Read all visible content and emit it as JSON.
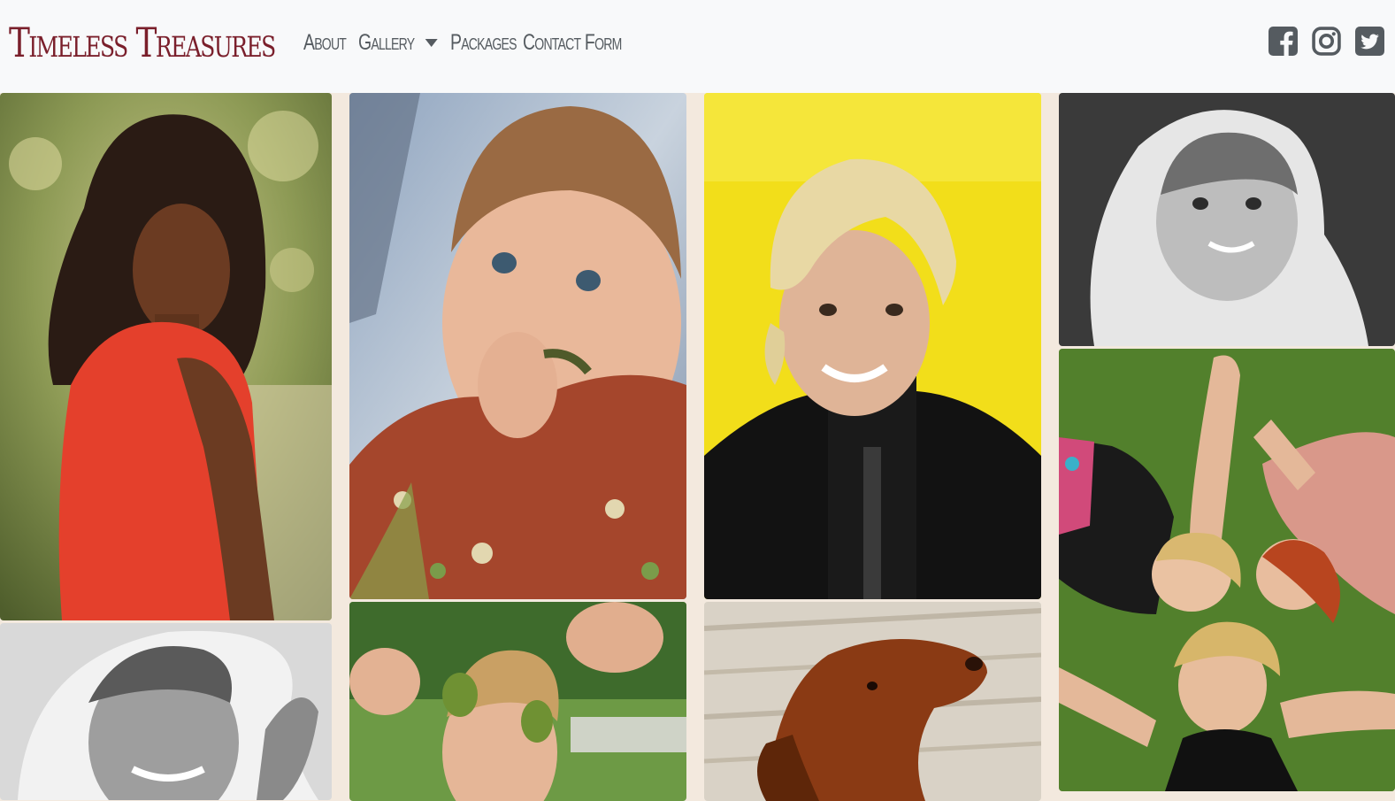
{
  "brand": {
    "name": "Timeless Treasures"
  },
  "nav": {
    "about": "About",
    "gallery": "Gallery",
    "packages": "Packages",
    "contact": "Contact Form"
  },
  "social": {
    "icons": [
      "facebook-icon",
      "instagram-icon",
      "twitter-icon"
    ]
  },
  "colors": {
    "brand": "#7a1f2b",
    "nav_text": "#555b60",
    "navbar_bg": "#f8f9fa",
    "page_bg": "#f3e9de"
  },
  "gallery": {
    "photos": [
      {
        "subject": "woman-red-dress"
      },
      {
        "subject": "older-woman-hat-bw"
      },
      {
        "subject": "baby-floral-shirt"
      },
      {
        "subject": "boy-acorns"
      },
      {
        "subject": "woman-yellow-background"
      },
      {
        "subject": "brown-dog"
      },
      {
        "subject": "toddler-hood-bw"
      },
      {
        "subject": "three-women-grass"
      }
    ]
  }
}
